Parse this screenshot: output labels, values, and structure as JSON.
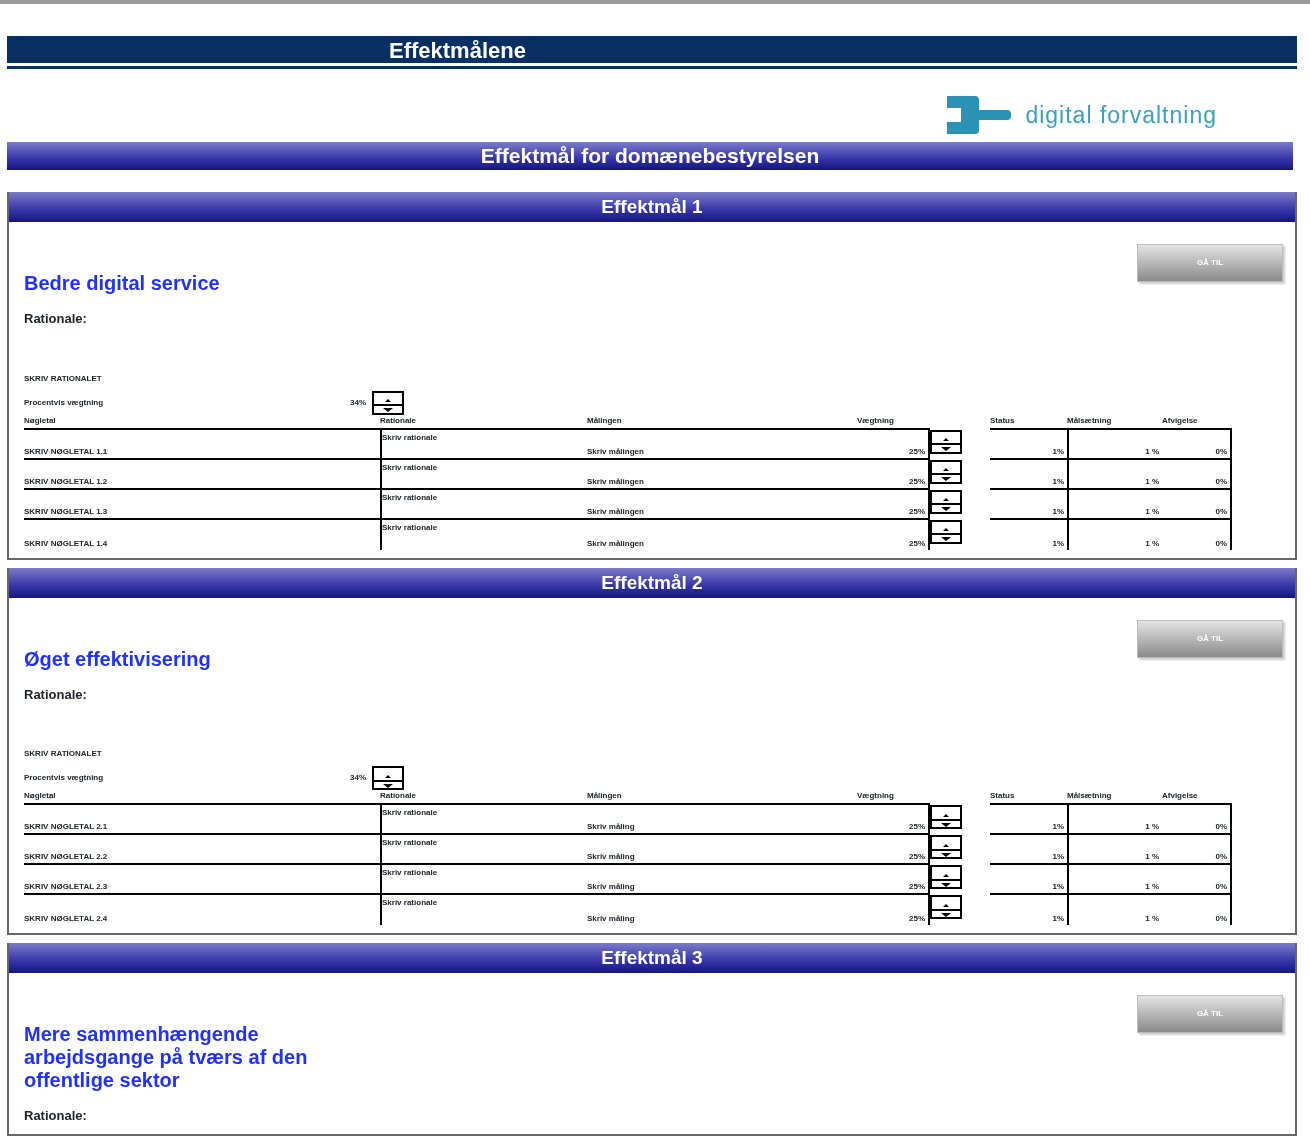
{
  "title": "Effektmålene",
  "logo_text": "digital forvaltning",
  "subtitle": "Effektmål for domænebestyrelsen",
  "goals": [
    {
      "header": "Effektmål 1",
      "title": "Bedre digital service",
      "button": "GÅ TIL",
      "rationale_label": "Rationale:",
      "rationale_text": "SKRIV RATIONALET",
      "weight_label": "Procentvis vægtning",
      "weight_value": "34%",
      "columns": [
        "Nøgletal",
        "Rationale",
        "Målingen",
        "Vægtning",
        "Status",
        "Målsætning",
        "Afvigelse"
      ],
      "rows": [
        {
          "key": "SKRIV NØGLETAL 1.1",
          "rationale": "Skriv rationale",
          "measure": "Skriv målingen",
          "weight": "25%",
          "status": "1%",
          "target": "1 %",
          "deviation": "0%"
        },
        {
          "key": "SKRIV NØGLETAL 1.2",
          "rationale": "Skriv rationale",
          "measure": "Skriv målingen",
          "weight": "25%",
          "status": "1%",
          "target": "1 %",
          "deviation": "0%"
        },
        {
          "key": "SKRIV NØGLETAL 1.3",
          "rationale": "Skriv rationale",
          "measure": "Skriv målingen",
          "weight": "25%",
          "status": "1%",
          "target": "1 %",
          "deviation": "0%"
        },
        {
          "key": "SKRIV NØGLETAL 1.4",
          "rationale": "Skriv rationale",
          "measure": "Skriv målingen",
          "weight": "25%",
          "status": "1%",
          "target": "1 %",
          "deviation": "0%"
        }
      ]
    },
    {
      "header": "Effektmål 2",
      "title": "Øget effektivisering",
      "button": "GÅ TIL",
      "rationale_label": "Rationale:",
      "rationale_text": "SKRIV RATIONALET",
      "weight_label": "Procentvis vægtning",
      "weight_value": "34%",
      "columns": [
        "Nøgletal",
        "Rationale",
        "Målingen",
        "Vægtning",
        "Status",
        "Målsætning",
        "Afvigelse"
      ],
      "rows": [
        {
          "key": "SKRIV NØGLETAL 2.1",
          "rationale": "Skriv rationale",
          "measure": "Skriv måling",
          "weight": "25%",
          "status": "1%",
          "target": "1 %",
          "deviation": "0%"
        },
        {
          "key": "SKRIV NØGLETAL 2.2",
          "rationale": "Skriv rationale",
          "measure": "Skriv måling",
          "weight": "25%",
          "status": "1%",
          "target": "1 %",
          "deviation": "0%"
        },
        {
          "key": "SKRIV NØGLETAL 2.3",
          "rationale": "Skriv rationale",
          "measure": "Skriv måling",
          "weight": "25%",
          "status": "1%",
          "target": "1 %",
          "deviation": "0%"
        },
        {
          "key": "SKRIV NØGLETAL 2.4",
          "rationale": "Skriv rationale",
          "measure": "Skriv måling",
          "weight": "25%",
          "status": "1%",
          "target": "1 %",
          "deviation": "0%"
        }
      ]
    },
    {
      "header": "Effektmål 3",
      "title": "Mere sammenhængende arbejdsgange på tværs af den offentlige sektor",
      "button": "GÅ TIL",
      "rationale_label": "Rationale:"
    }
  ]
}
